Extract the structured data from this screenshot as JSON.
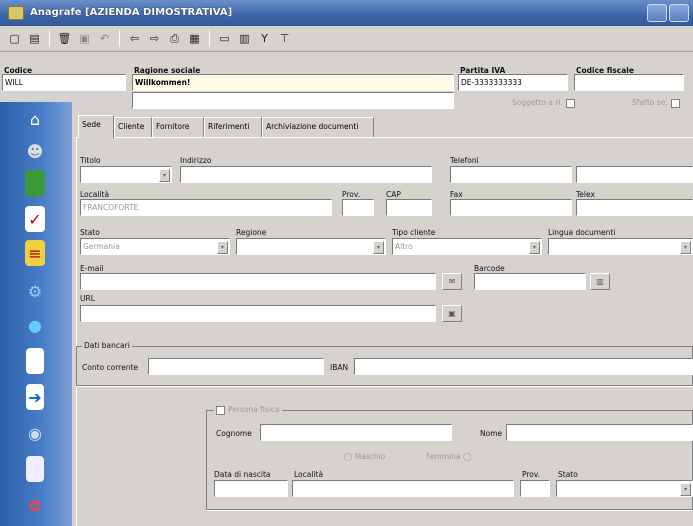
{
  "window": {
    "title": "Anagrafe [AZIENDA DIMOSTRATIVA]"
  },
  "toolbar": {
    "icons": [
      "new-icon",
      "list-icon",
      "delete-icon",
      "save-icon",
      "undo-icon",
      "prev-icon",
      "next-icon",
      "print-icon",
      "preview-icon",
      "view-icon",
      "table-icon",
      "filter-icon",
      "export-icon"
    ]
  },
  "header": {
    "codice_label": "Codice",
    "codice_value": "WILL",
    "ragione_label": "Ragione sociale",
    "ragione_value": "Willkommen!",
    "ragione_line2": "",
    "piva_label": "Partita IVA",
    "piva_value": "DE-3333333333",
    "cf_label": "Codice fiscale",
    "cf_value": "",
    "soggetto_label": "Soggetto a ri.",
    "sfatto_label": "Sfatto se."
  },
  "tabs": [
    {
      "label": "Sede",
      "active": true
    },
    {
      "label": "Cliente",
      "active": false
    },
    {
      "label": "Fornitore",
      "active": false
    },
    {
      "label": "Riferimenti",
      "active": false
    },
    {
      "label": "Archiviazione documenti",
      "active": false
    }
  ],
  "sede": {
    "titolo_label": "Titolo",
    "indirizzo_label": "Indirizzo",
    "telefoni_label": "Telefoni",
    "localita_label": "Località",
    "localita_value": "FRANCOFORTE",
    "prov_label": "Prov.",
    "cap_label": "CAP",
    "fax_label": "Fax",
    "telex_label": "Telex",
    "stato_label": "Stato",
    "stato_value": "Germania",
    "regione_label": "Regione",
    "tipo_label": "Tipo cliente",
    "tipo_value": "Altro",
    "lingua_label": "Lingua documenti",
    "email_label": "E-mail",
    "barcode_label": "Barcode",
    "url_label": "URL",
    "bancari_label": "Dati bancari",
    "conto_label": "Conto corrente",
    "iban_label": "IBAN",
    "persona_label": "Persona fisica",
    "cognome_label": "Cognome",
    "nome_label": "Nome",
    "maschio_label": "Maschio",
    "femmina_label": "Femmina",
    "nascita_label": "Data di nascita",
    "localita2_label": "Località",
    "prov2_label": "Prov.",
    "stato2_label": "Stato"
  },
  "sidebar": {
    "icons": [
      "home-icon",
      "people-icon",
      "book-icon",
      "checklist-icon",
      "notes-icon",
      "network-icon",
      "globe-icon",
      "document-icon",
      "forward-document-icon",
      "disk-icon",
      "page-icon",
      "settings-icon"
    ]
  }
}
